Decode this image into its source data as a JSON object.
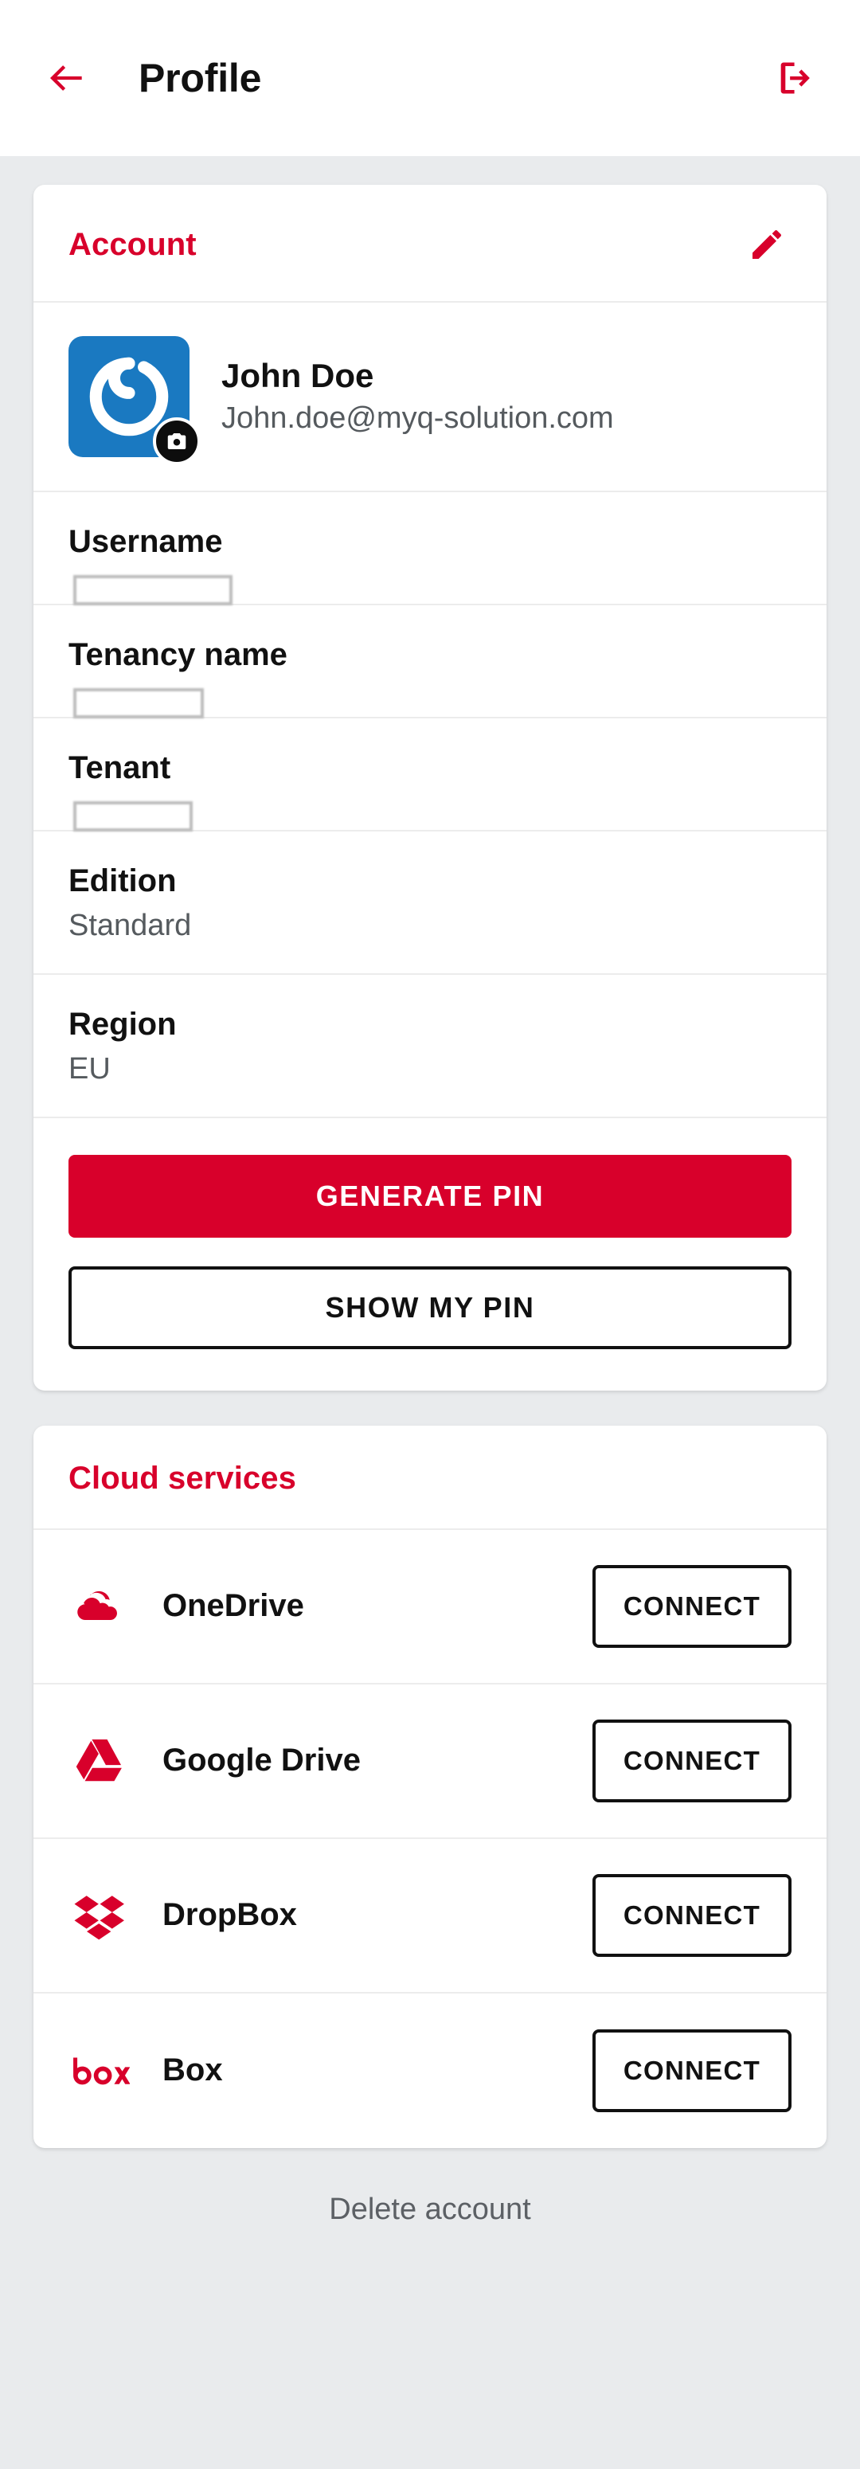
{
  "appbar": {
    "title": "Profile",
    "back_icon": "arrow-left-icon",
    "logout_icon": "logout-icon",
    "accent": "#d8002b"
  },
  "account_card": {
    "title": "Account",
    "edit_icon": "pencil-icon",
    "identity": {
      "name": "John Doe",
      "email": "John.doe@myq-solution.com",
      "avatar_icon": "myq-power-logo",
      "avatar_bg": "#1a79c1",
      "camera_badge_icon": "camera-icon"
    },
    "fields": [
      {
        "label": "Username",
        "value": "",
        "redacted": true,
        "cover_width": 200
      },
      {
        "label": "Tenancy name",
        "value": "",
        "redacted": true,
        "cover_width": 164
      },
      {
        "label": "Tenant",
        "value": "",
        "redacted": true,
        "cover_width": 150
      },
      {
        "label": "Edition",
        "value": "Standard",
        "redacted": false
      },
      {
        "label": "Region",
        "value": "EU",
        "redacted": false
      }
    ],
    "generate_pin_label": "GENERATE PIN",
    "show_pin_label": "SHOW MY PIN"
  },
  "cloud_card": {
    "title": "Cloud services",
    "connect_label": "CONNECT",
    "services": [
      {
        "name": "OneDrive",
        "icon": "onedrive-icon",
        "action": "CONNECT"
      },
      {
        "name": "Google Drive",
        "icon": "google-drive-icon",
        "action": "CONNECT"
      },
      {
        "name": "DropBox",
        "icon": "dropbox-icon",
        "action": "CONNECT"
      },
      {
        "name": "Box",
        "icon": "box-icon",
        "action": "CONNECT"
      }
    ]
  },
  "footer": {
    "delete_account_label": "Delete account"
  }
}
